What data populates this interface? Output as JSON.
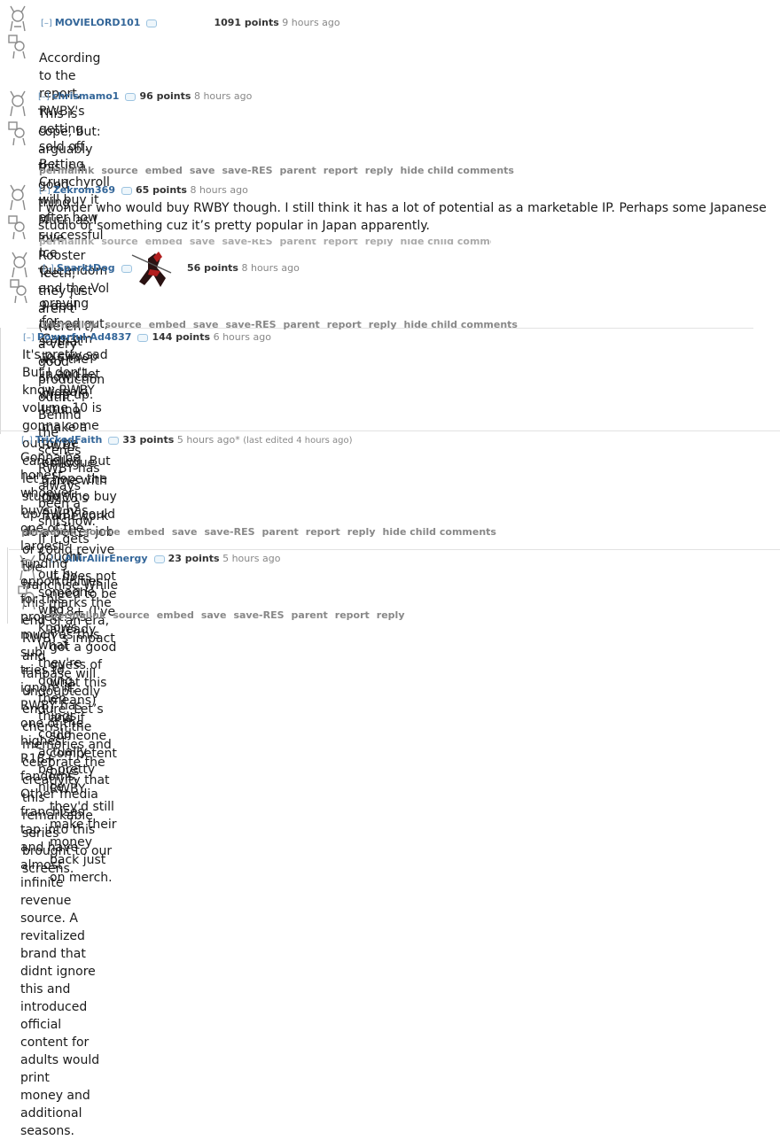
{
  "buttons": {
    "permalink": "permalink",
    "source": "source",
    "embed": "embed",
    "save": "save",
    "save_res": "save-RES",
    "parent": "parent",
    "report": "report",
    "reply": "reply",
    "hide_child": "hide child comments"
  },
  "colors": {
    "author": "#336699",
    "meta": "#888888",
    "text": "#1a1a1a",
    "flair": "#9cc3e0"
  },
  "comments": [
    {
      "toggle": "[–]",
      "author": "MOVIELORD101",
      "score": "1091 points",
      "time": "9 hours ago",
      "lines": [
        "According to the report, RWBY's getting sold off. Betting Crunchyroll will buy it after how successful Ice Queendom",
        "and the Vol 9 deal turned out, so that way the show can wrap up."
      ]
    },
    {
      "toggle": "[–]",
      "author": "chrismamo1",
      "score": "96 points",
      "time": "8 hours ago",
      "lines": [
        "This is cope, but: arguably this is a good thing. Much as I love Rooster Teeth, they just aren't (weren't) a very good",
        "production outfit. Behind the scenes RWBY has always been a shitshow. If it gets bought out by someone who knows",
        "what they're doing, then things could actually be pretty nice."
      ]
    },
    {
      "toggle": "[–]",
      "author": "Zekrom369",
      "score": "65 points",
      "time": "8 hours ago",
      "lines": [
        "I wonder who would buy RWBY though. I still think it has a lot of potential as a marketable IP. Perhaps some Japanese",
        "studio or something cuz it’s pretty popular in Japan apparently."
      ]
    },
    {
      "toggle": "[–]",
      "author": "SparktDog",
      "score": "56 points",
      "time": "8 hours ago",
      "lines": [
        "praying for Capcom to swoop in and let Hideaki Istuno make a RWBY epilogue game with DMC5's framework"
      ]
    },
    {
      "toggle": "[–]",
      "author": "Powerful-Ad4837",
      "score": "144 points",
      "time": "6 hours ago",
      "lines": [
        "It's pretty sad But I don't know RWBY volume 10 is gonna come out or be cancelled. But let's hope the studio who buy",
        "up RWBY could do a better job or could revive the franchise.While this marks the end of an era, RWBY’s impact and",
        "fanbase will undoubtedly endure. Let’s cherish the memories and celebrate the creativity that this remarkable series",
        "brought to our screens."
      ]
    },
    {
      "toggle": "[–]",
      "author": "TrickedFaith",
      "score": "33 points",
      "time": "5 hours ago*",
      "edited": "(last edited 4 hours ago)",
      "lines": [
        "Gonna be honest, whoever buys it has one of the largest funding opportunities for this project. As much as this sub",
        "tries to ignore it, RWBY has one of the highest R18+ fandoms. Other media franchises tap into this and have almost",
        "infinite revenue source. A revitalized brand that didnt ignore this and introduced official content for adults would print",
        "money and additional seasons."
      ]
    },
    {
      "toggle": "[–]",
      "author": "AliirAliirEnergy",
      "score": "23 points",
      "time": "5 hours ago",
      "lines": [
        "It does not need to be R18+ (I've already got a good guess of what this means) and if someone competent buys",
        "RWBY they'd still make their money back just on merch."
      ]
    }
  ]
}
